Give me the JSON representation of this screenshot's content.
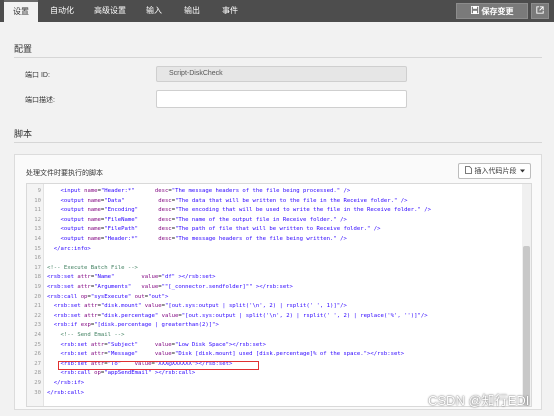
{
  "tabs": [
    "设置",
    "自动化",
    "高级设置",
    "输入",
    "输出",
    "事件"
  ],
  "toolbar": {
    "save_label": "保存变更",
    "save_icon": "save-icon",
    "external_icon": "external-link-icon"
  },
  "config": {
    "title": "配置",
    "id_label": "端口 ID:",
    "id_value": "Script-DiskCheck",
    "desc_label": "端口描述:",
    "desc_value": ""
  },
  "script": {
    "title": "脚本",
    "panel_label": "处理文件时要执行的脚本",
    "snippet_button": "插入代码片段",
    "lines": [
      {
        "n": "9",
        "html": "    <span class='tag'>&lt;input</span> <span class='attr'>name</span>=<span class='str'>\"Header:*\"</span>      <span class='attr'>desc</span>=<span class='str'>\"The message headers of the file being processed.\"</span> <span class='tag'>/&gt;</span>"
      },
      {
        "n": "10",
        "html": "    <span class='tag'>&lt;output</span> <span class='attr'>name</span>=<span class='str'>\"Data\"</span>          <span class='attr'>desc</span>=<span class='str'>\"The data that will be written to the file in the Receive folder.\"</span> <span class='tag'>/&gt;</span>"
      },
      {
        "n": "11",
        "html": "    <span class='tag'>&lt;output</span> <span class='attr'>name</span>=<span class='str'>\"Encoding\"</span>      <span class='attr'>desc</span>=<span class='str'>\"The encoding that will be used to write the file in the Receive folder.\"</span> <span class='tag'>/&gt;</span>"
      },
      {
        "n": "12",
        "html": "    <span class='tag'>&lt;output</span> <span class='attr'>name</span>=<span class='str'>\"FileName\"</span>      <span class='attr'>desc</span>=<span class='str'>\"The name of the output file in Receive folder.\"</span> <span class='tag'>/&gt;</span>"
      },
      {
        "n": "13",
        "html": "    <span class='tag'>&lt;output</span> <span class='attr'>name</span>=<span class='str'>\"FilePath\"</span>      <span class='attr'>desc</span>=<span class='str'>\"The path of file that will be written to Receive folder.\"</span> <span class='tag'>/&gt;</span>"
      },
      {
        "n": "14",
        "html": "    <span class='tag'>&lt;output</span> <span class='attr'>name</span>=<span class='str'>\"Header:*\"</span>      <span class='attr'>desc</span>=<span class='str'>\"The message headers of the file being written.\"</span> <span class='tag'>/&gt;</span>"
      },
      {
        "n": "15",
        "html": "  <span class='tag'>&lt;/arc:info&gt;</span>"
      },
      {
        "n": "16",
        "html": ""
      },
      {
        "n": "17",
        "html": "<span class='cmt'>&lt;!-- Execute Batch File --&gt;</span>"
      },
      {
        "n": "18",
        "html": "<span class='tag'>&lt;rsb:set</span> <span class='attr'>attr</span>=<span class='str'>\"Name\"</span>        <span class='attr'>value</span>=<span class='str'>\"df\"</span> <span class='tag'>&gt;&lt;/rsb:set&gt;</span>"
      },
      {
        "n": "19",
        "html": "<span class='tag'>&lt;rsb:set</span> <span class='attr'>attr</span>=<span class='str'>\"Arguments\"</span>   <span class='attr'>value</span>=<span class='str'>\"\"[_connector.sendfolder]\"\"</span> <span class='tag'>&gt;&lt;/rsb:set&gt;</span>"
      },
      {
        "n": "20",
        "html": "<span class='tag'>&lt;rsb:call</span> <span class='attr'>op</span>=<span class='str'>\"sysExecute\"</span> <span class='attr'>out</span>=<span class='str'>\"out\"</span><span class='tag'>&gt;</span>"
      },
      {
        "n": "21",
        "html": "  <span class='tag'>&lt;rsb:set</span> <span class='attr'>attr</span>=<span class='str'>\"disk.mount\"</span> <span class='attr'>value</span>=<span class='str'>\"[out.sys:output | split('\\n', 2) | rsplit(' ', 1)]\"</span><span class='tag'>/&gt;</span>"
      },
      {
        "n": "22",
        "html": "  <span class='tag'>&lt;rsb:set</span> <span class='attr'>attr</span>=<span class='str'>\"disk.percentage\"</span> <span class='attr'>value</span>=<span class='str'>\"[out.sys:output | split('\\n', 2) | rsplit(' ', 2) | replace('%', '')]\"</span><span class='tag'>/&gt;</span>"
      },
      {
        "n": "23",
        "html": "  <span class='tag'>&lt;rsb:if</span> <span class='attr'>exp</span>=<span class='str'>\"[disk.percentage | greaterthan(2)]\"</span><span class='tag'>&gt;</span>"
      },
      {
        "n": "24",
        "html": "    <span class='cmt'>&lt;!-- Send Email --&gt;</span>"
      },
      {
        "n": "25",
        "html": "    <span class='tag'>&lt;rsb:set</span> <span class='attr'>attr</span>=<span class='str'>\"Subject\"</span>     <span class='attr'>value</span>=<span class='str'>\"Low Disk Space\"</span><span class='tag'>&gt;&lt;/rsb:set&gt;</span>"
      },
      {
        "n": "26",
        "html": "    <span class='tag'>&lt;rsb:set</span> <span class='attr'>attr</span>=<span class='str'>\"Message\"</span>     <span class='attr'>value</span>=<span class='str'>\"Disk [disk.mount] used [disk.percentage]% of the space.\"</span><span class='tag'>&gt;&lt;/rsb:set&gt;</span>"
      },
      {
        "n": "27",
        "html": "    <span class='tag'>&lt;rsb:set</span> <span class='attr'>attr</span>=<span class='str'>\"To\"</span>    <span class='attr'>value</span>=<span class='str'>\"XXX@XXXXXX\"</span><span class='tag'>&gt;&lt;/rsb:set&gt;</span>"
      },
      {
        "n": "28",
        "html": "    <span class='tag'>&lt;rsb:call</span> <span class='attr'>op</span>=<span class='str'>\"appSendEmail\"</span> <span class='tag'>&gt;&lt;/rsb:call&gt;</span>"
      },
      {
        "n": "29",
        "html": "  <span class='tag'>&lt;/rsb:if&gt;</span>"
      },
      {
        "n": "30",
        "html": "<span class='tag'>&lt;/rsb:call&gt;</span>"
      }
    ]
  },
  "watermark": "CSDN @知行EDI"
}
